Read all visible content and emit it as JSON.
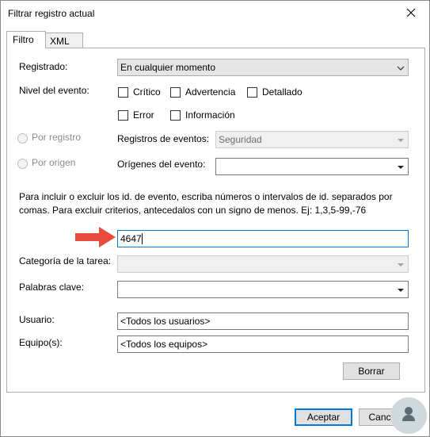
{
  "window": {
    "title": "Filtrar registro actual"
  },
  "tabs": [
    {
      "label": "Filtro"
    },
    {
      "label": "XML"
    }
  ],
  "filter": {
    "logged_label": "Registrado:",
    "logged_value": "En cualquier momento",
    "event_level_label": "Nivel del evento:",
    "levels": {
      "critical": "Crítico",
      "warning": "Advertencia",
      "verbose": "Detallado",
      "error": "Error",
      "information": "Información"
    },
    "by_log_label": "Por registro",
    "by_source_label": "Por origen",
    "event_logs_label": "Registros de eventos:",
    "event_logs_value": "Seguridad",
    "event_sources_label": "Orígenes del evento:",
    "event_sources_value": "",
    "help_text_line1": "Para incluir o excluir los id. de evento, escriba números o intervalos de id. separados por",
    "help_text_line2": "comas. Para excluir criterios, antecedalos con un signo de menos. Ej: 1,3,5-99,-76",
    "event_ids_value": "4647",
    "task_category_label": "Categoría de la tarea:",
    "task_category_value": "",
    "keywords_label": "Palabras clave:",
    "keywords_value": "",
    "user_label": "Usuario:",
    "user_value": "<Todos los usuarios>",
    "computer_label": "Equipo(s):",
    "computer_value": "<Todos los equipos>",
    "clear_button": "Borrar"
  },
  "footer": {
    "ok_button": "Aceptar",
    "cancel_button": "Cancelar"
  },
  "colors": {
    "accent": "#0078d7",
    "annotation_arrow": "#e74c3c"
  }
}
